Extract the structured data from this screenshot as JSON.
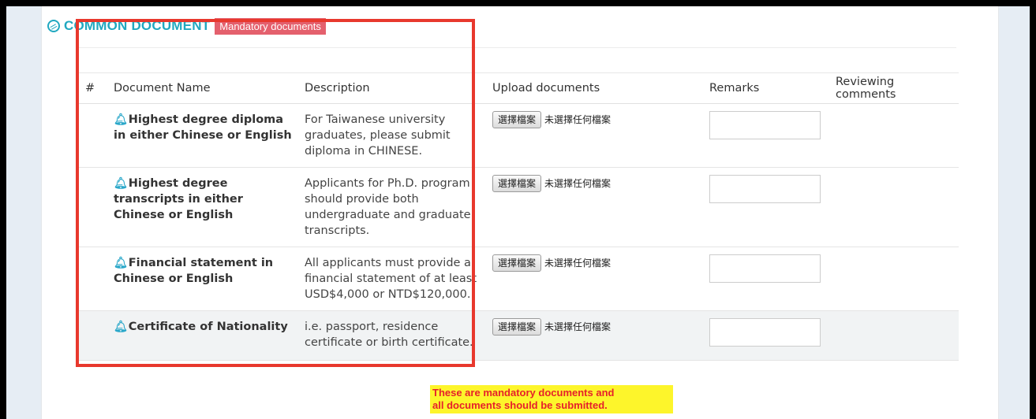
{
  "section": {
    "title": "COMMON DOCUMENT",
    "badge": "Mandatory documents"
  },
  "table": {
    "headers": {
      "num": "#",
      "name": "Document Name",
      "description": "Description",
      "upload": "Upload documents",
      "remarks": "Remarks",
      "reviewing": "Reviewing comments"
    },
    "rows": [
      {
        "name": "Highest degree diploma in either Chinese or English",
        "description": "For Taiwanese university graduates, please submit diploma in CHINESE.",
        "file_button": "選擇檔案",
        "file_status": "未選擇任何檔案",
        "remarks": "",
        "reviewing": ""
      },
      {
        "name": "Highest degree transcripts in either Chinese or English",
        "description": "Applicants for Ph.D. program should provide both undergraduate and graduate transcripts.",
        "file_button": "選擇檔案",
        "file_status": "未選擇任何檔案",
        "remarks": "",
        "reviewing": ""
      },
      {
        "name": "Financial statement in Chinese or English",
        "description": "All applicants must provide a financial statement of at least USD$4,000 or NTD$120,000.",
        "file_button": "選擇檔案",
        "file_status": "未選擇任何檔案",
        "remarks": "",
        "reviewing": ""
      },
      {
        "name": "Certificate of Nationality",
        "description": "i.e. passport, residence certificate or birth certificate.",
        "file_button": "選擇檔案",
        "file_status": "未選擇任何檔案",
        "remarks": "",
        "reviewing": ""
      }
    ]
  },
  "annotation": {
    "line1": "These are mandatory documents and",
    "line2": "all documents should be submitted."
  },
  "colors": {
    "accent": "#20a8c0",
    "badge": "#e4606d",
    "highlight_border": "#e8382d",
    "note_background": "#fdf52b",
    "note_text": "#e6202b"
  },
  "icons": {
    "section": "dribbble-icon",
    "document": "bell-icon"
  }
}
